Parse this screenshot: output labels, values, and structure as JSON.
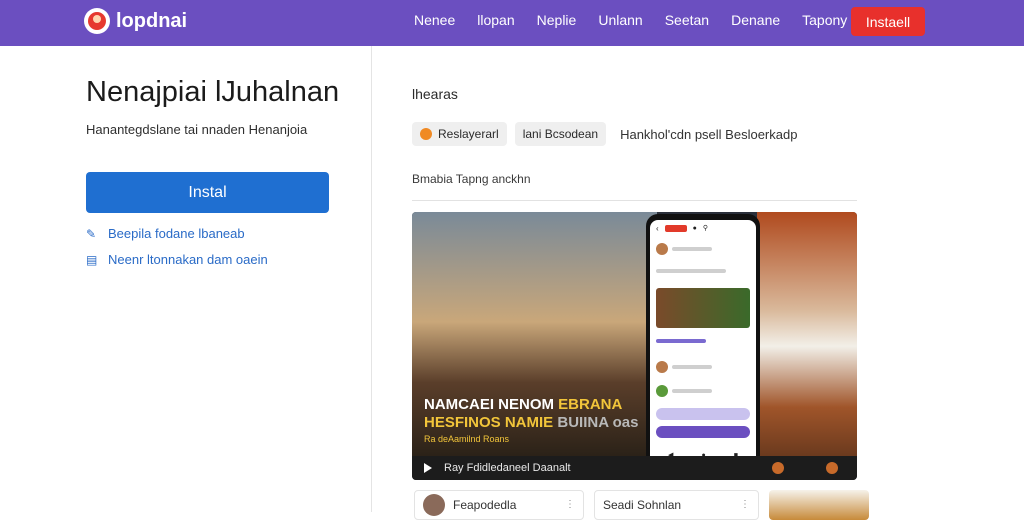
{
  "topbar": {
    "brand": "lopdnai",
    "nav": [
      "Nenee",
      "llopan",
      "Neplie",
      "Unlann",
      "Seetan",
      "Denane",
      "Tapony"
    ],
    "install_label": "Instaell",
    "accent": "#6b4fc0",
    "install_color": "#e8302c"
  },
  "left": {
    "headline": "Nenajpiai lJuhalnan",
    "subline": "Hanantegdslane tai nnaden Henanjoia",
    "install_label": "Instal",
    "install_color": "#1f6fd1",
    "links": [
      {
        "icon": "edit-icon",
        "label": "Beepila fodane lbaneab"
      },
      {
        "icon": "share-icon",
        "label": "Neenr ltonnakan dam oaein"
      }
    ]
  },
  "right": {
    "section_label": "lhearas",
    "chips": [
      {
        "label": "Reslayerarl",
        "icon": "orange-dot-icon"
      },
      {
        "label": "lani Bcsodean"
      }
    ],
    "chip_trailing": "Hankhol'cdn psell Besloerkadp",
    "caption": "Bmabia Tapng anckhn",
    "hero": {
      "title_line1_white": "NAMCAEI NENOM",
      "title_line1_yellow": "EBRANA",
      "title_line2": "HESFINOS NAMIE",
      "title_line2_faded": "BUIINA oas",
      "tagline": "Ra deAamilnd Roans",
      "bar_text": "Ray Fdidledaneel Daanalt"
    },
    "cards": [
      {
        "label": "Feapodedla"
      },
      {
        "label": "Seadi Sohnlan"
      }
    ]
  }
}
